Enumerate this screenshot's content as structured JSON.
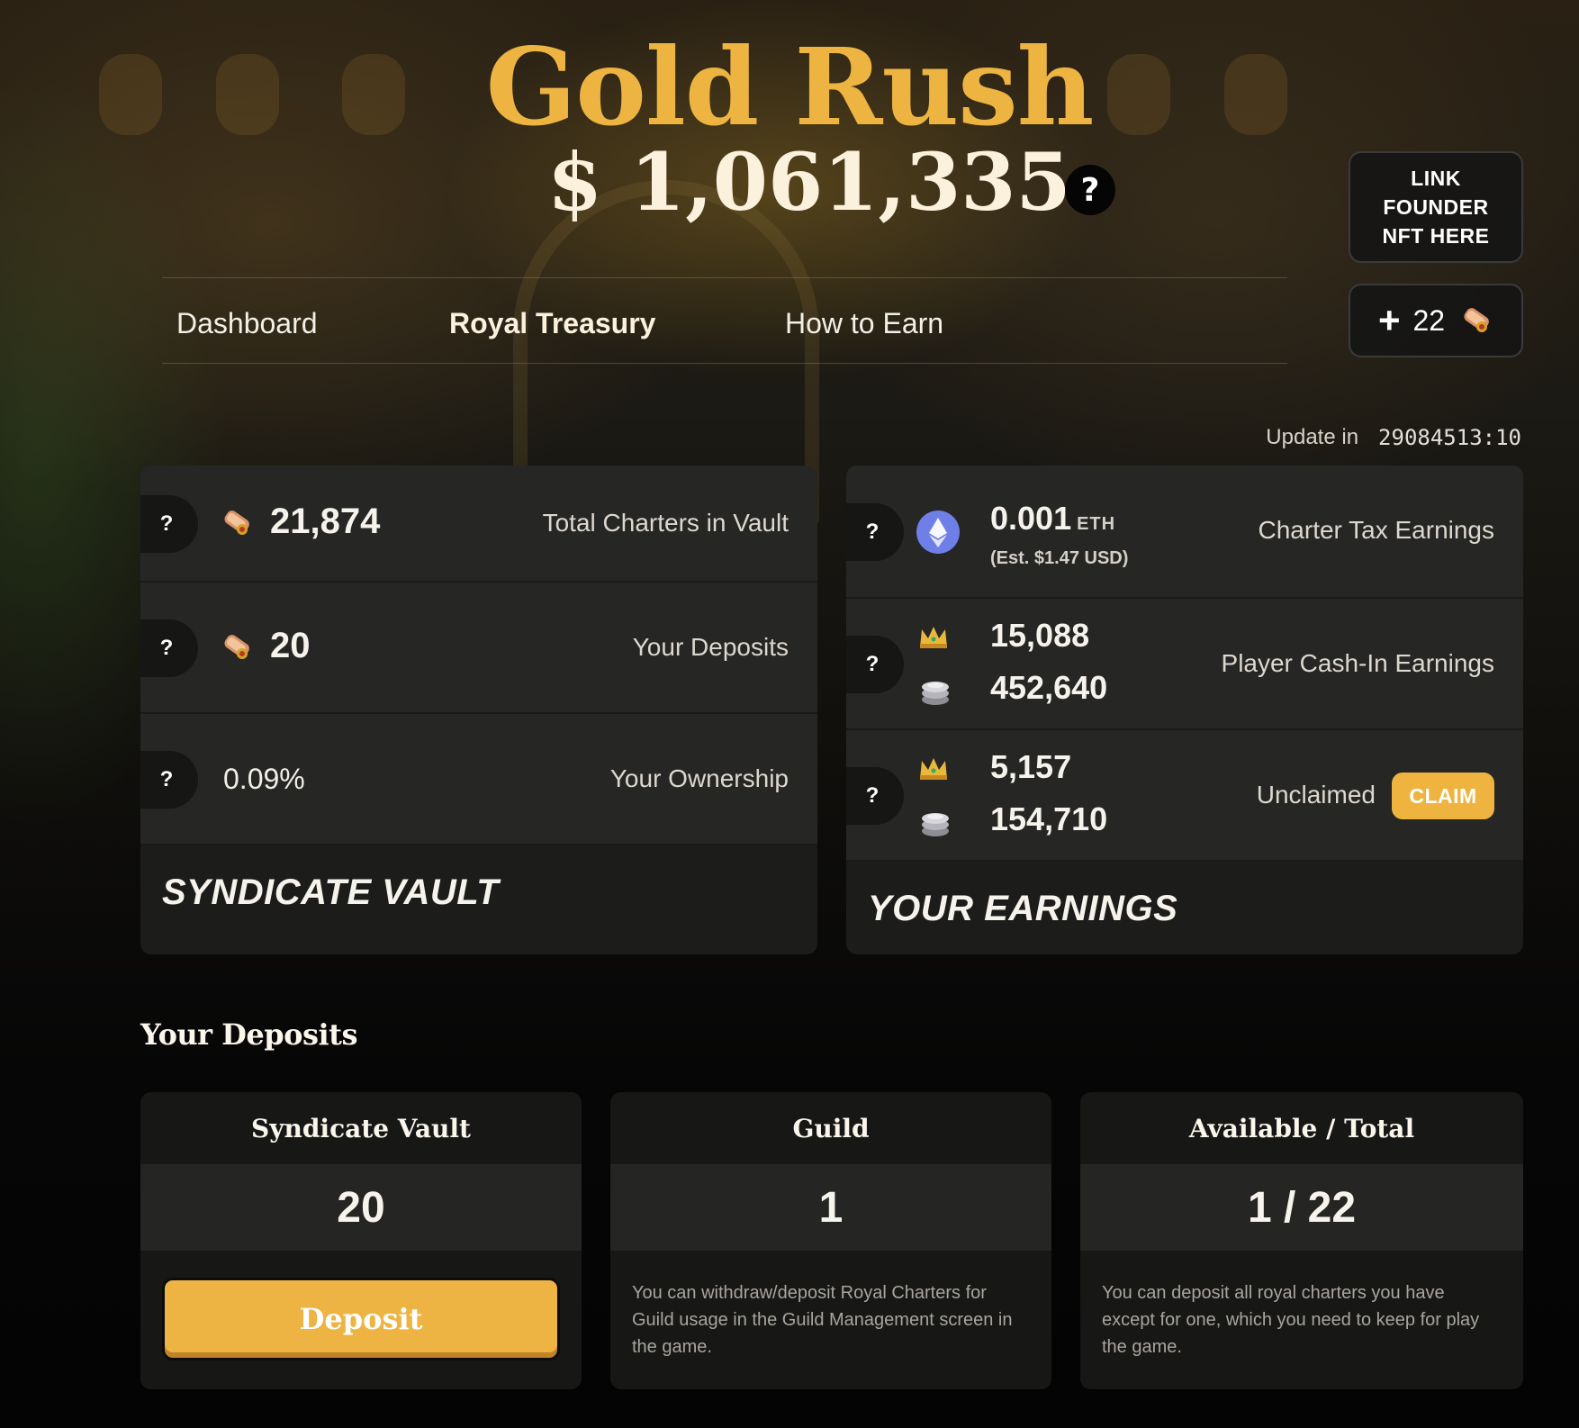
{
  "header": {
    "title": "Gold Rush",
    "prize_pool": "$ 1,061,335",
    "help_label": "?",
    "link_nft_button": "LINK FOUNDER NFT HERE",
    "charters_count": "22"
  },
  "nav": {
    "tabs": [
      "Dashboard",
      "Royal Treasury",
      "How to Earn"
    ],
    "active": "Royal Treasury"
  },
  "update": {
    "label": "Update in",
    "timer": "29084513:10"
  },
  "vault": {
    "title": "SYNDICATE VAULT",
    "rows": [
      {
        "help": "?",
        "value": "21,874",
        "label": "Total Charters in Vault"
      },
      {
        "help": "?",
        "value": "20",
        "label": "Your Deposits"
      },
      {
        "help": "?",
        "value": "0.09%",
        "label": "Your Ownership"
      }
    ]
  },
  "earnings": {
    "title": "YOUR EARNINGS",
    "tax": {
      "help": "?",
      "value": "0.001",
      "unit": "ETH",
      "estimate": "(Est. $1.47 USD)",
      "label": "Charter Tax Earnings"
    },
    "cash_in": {
      "help": "?",
      "crowns": "15,088",
      "silver": "452,640",
      "label": "Player Cash-In Earnings"
    },
    "unclaimed": {
      "help": "?",
      "crowns": "5,157",
      "silver": "154,710",
      "label": "Unclaimed",
      "claim_button": "CLAIM"
    }
  },
  "deposits": {
    "section_title": "Your Deposits",
    "cards": [
      {
        "head": "Syndicate Vault",
        "value": "20",
        "button": "Deposit"
      },
      {
        "head": "Guild",
        "value": "1",
        "note": "You can withdraw/deposit Royal Charters for Guild usage in the Guild Management screen in the game."
      },
      {
        "head": "Available / Total",
        "value": "1 / 22",
        "note": "You can deposit all royal charters you have except for one, which you need to keep for play the game."
      }
    ]
  },
  "colors": {
    "gold": "#edb442",
    "claim": "#efb43f",
    "panel": "#1c1c1a",
    "row": "#262624",
    "eth": "#6f7fe8"
  },
  "icons": [
    "scroll-charter-icon",
    "eth-icon",
    "crown-icon",
    "silver-coins-icon",
    "help-icon",
    "plus-icon"
  ]
}
